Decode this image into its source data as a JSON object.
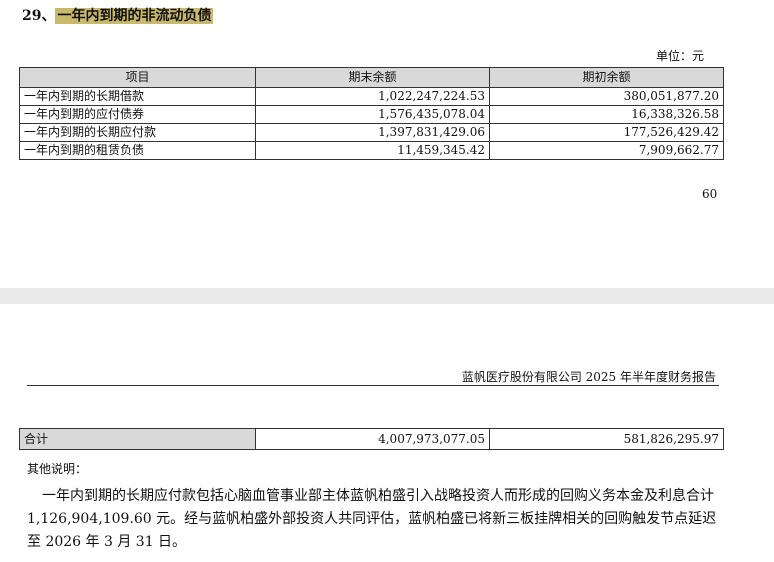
{
  "section": {
    "number": "29、",
    "title": "一年内到期的非流动负债"
  },
  "unit_label": "单位：元",
  "table": {
    "headers": [
      "项目",
      "期末余额",
      "期初余额"
    ],
    "rows": [
      [
        "一年内到期的长期借款",
        "1,022,247,224.53",
        "380,051,877.20"
      ],
      [
        "一年内到期的应付债券",
        "1,576,435,078.04",
        "16,338,326.58"
      ],
      [
        "一年内到期的长期应付款",
        "1,397,831,429.06",
        "177,526,429.42"
      ],
      [
        "一年内到期的租赁负债",
        "11,459,345.42",
        "7,909,662.77"
      ]
    ]
  },
  "page_number": "60",
  "report_header": "蓝帆医疗股份有限公司 2025 年半年度财务报告",
  "total_row": [
    "合计",
    "4,007,973,077.05",
    "581,826,295.97"
  ],
  "note_label": "其他说明：",
  "note_text": "一年内到期的长期应付款包括心脑血管事业部主体蓝帆柏盛引入战略投资人而形成的回购义务本金及利息合计 1,126,904,109.60 元。经与蓝帆柏盛外部投资人共同评估，蓝帆柏盛已将新三板挂牌相关的回购触发节点延迟至 2026 年 3 月 31 日。"
}
